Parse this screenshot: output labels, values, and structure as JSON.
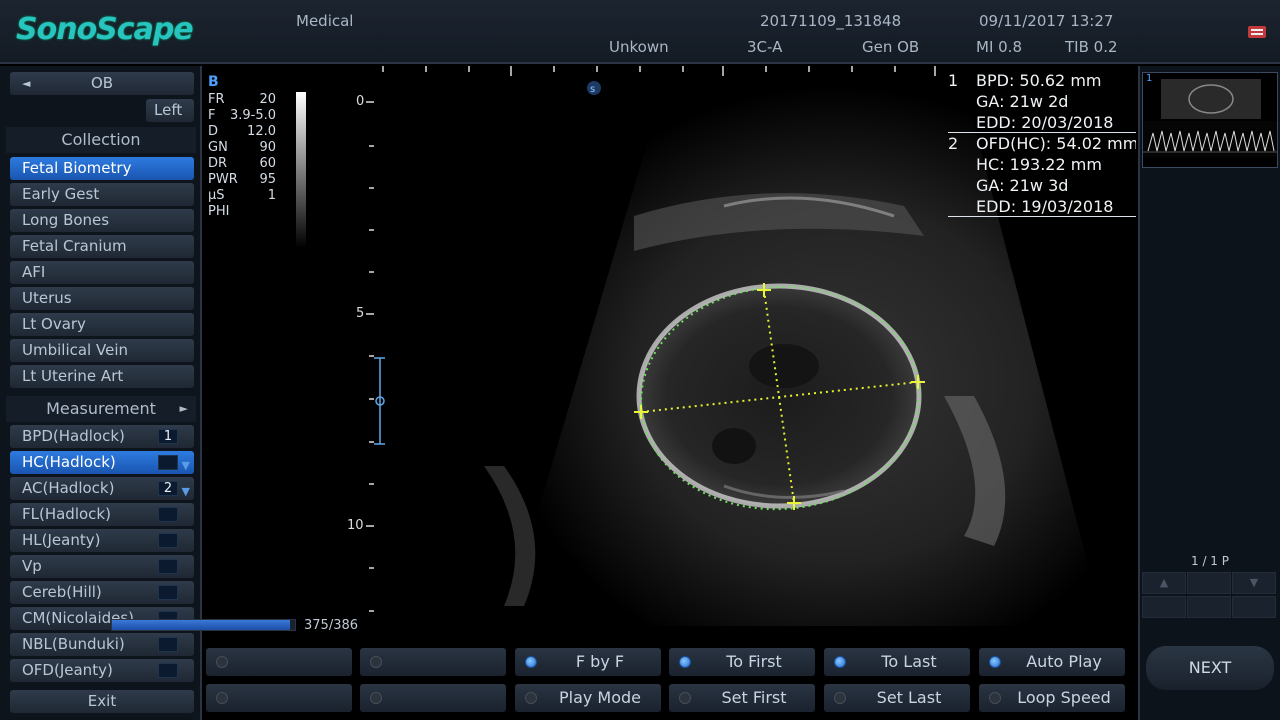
{
  "header": {
    "logo": "SonoScape",
    "preset": "Medical",
    "exam_id": "20171109_131848",
    "datetime": "09/11/2017 13:27",
    "patient": "Unkown",
    "probe": "3C-A",
    "exam_type": "Gen OB",
    "mi": "MI 0.8",
    "tib": "TIB 0.2"
  },
  "left_panel": {
    "mode": "OB",
    "side": "Left",
    "collection_title": "Collection",
    "collection": [
      "Fetal Biometry",
      "Early Gest",
      "Long Bones",
      "Fetal Cranium",
      "AFI",
      "Uterus",
      "Lt Ovary",
      "Umbilical Vein",
      "Lt Uterine Art"
    ],
    "selected_collection": "Fetal Biometry",
    "measurement_title": "Measurement",
    "measurements": [
      {
        "label": "BPD(Hadlock)",
        "badge": "1"
      },
      {
        "label": "HC(Hadlock)",
        "badge": ""
      },
      {
        "label": "AC(Hadlock)",
        "badge": "2"
      },
      {
        "label": "FL(Hadlock)",
        "badge": ""
      },
      {
        "label": "HL(Jeanty)",
        "badge": ""
      },
      {
        "label": "Vp",
        "badge": ""
      },
      {
        "label": "Cereb(Hill)",
        "badge": ""
      },
      {
        "label": "CM(Nicolaides)",
        "badge": ""
      },
      {
        "label": "NBL(Bunduki)",
        "badge": ""
      },
      {
        "label": "OFD(Jeanty)",
        "badge": ""
      }
    ],
    "selected_measurement": "HC(Hadlock)",
    "exit": "Exit"
  },
  "image": {
    "mode_label": "B",
    "params": [
      {
        "k": "FR",
        "v": "20"
      },
      {
        "k": "F",
        "v": "3.9-5.0"
      },
      {
        "k": "D",
        "v": "12.0"
      },
      {
        "k": "GN",
        "v": "90"
      },
      {
        "k": "DR",
        "v": "60"
      },
      {
        "k": "PWR",
        "v": "95"
      },
      {
        "k": "µS",
        "v": "1"
      },
      {
        "k": "PHI",
        "v": ""
      }
    ],
    "depth_labels": [
      "0",
      "5",
      "10"
    ],
    "frame_count": "375/386",
    "frame_progress": 0.97,
    "results": {
      "m1_index": "1",
      "m1_line1": "BPD: 50.62  mm",
      "m1_line2": "GA: 21w 2d",
      "m1_line3": "EDD: 20/03/2018",
      "m2_index": "2",
      "m2_line1": "OFD(HC): 54.02  mm",
      "m2_line2": "HC: 193.22 mm",
      "m2_line3": "GA: 21w 3d",
      "m2_line4": "EDD: 19/03/2018"
    }
  },
  "bottom_buttons": [
    {
      "label": "",
      "active": false
    },
    {
      "label": "",
      "active": false
    },
    {
      "label": "F by F",
      "active": true
    },
    {
      "label": "To First",
      "active": true
    },
    {
      "label": "To Last",
      "active": true
    },
    {
      "label": "Auto Play",
      "active": true
    },
    {
      "label": "",
      "active": false
    },
    {
      "label": "",
      "active": false
    },
    {
      "label": "Play Mode",
      "active": false
    },
    {
      "label": "Set First",
      "active": false
    },
    {
      "label": "Set Last",
      "active": false
    },
    {
      "label": "Loop Speed",
      "active": false
    }
  ],
  "right_panel": {
    "thumb_index": "1",
    "page_indicator": "1 / 1 P",
    "next": "NEXT"
  }
}
